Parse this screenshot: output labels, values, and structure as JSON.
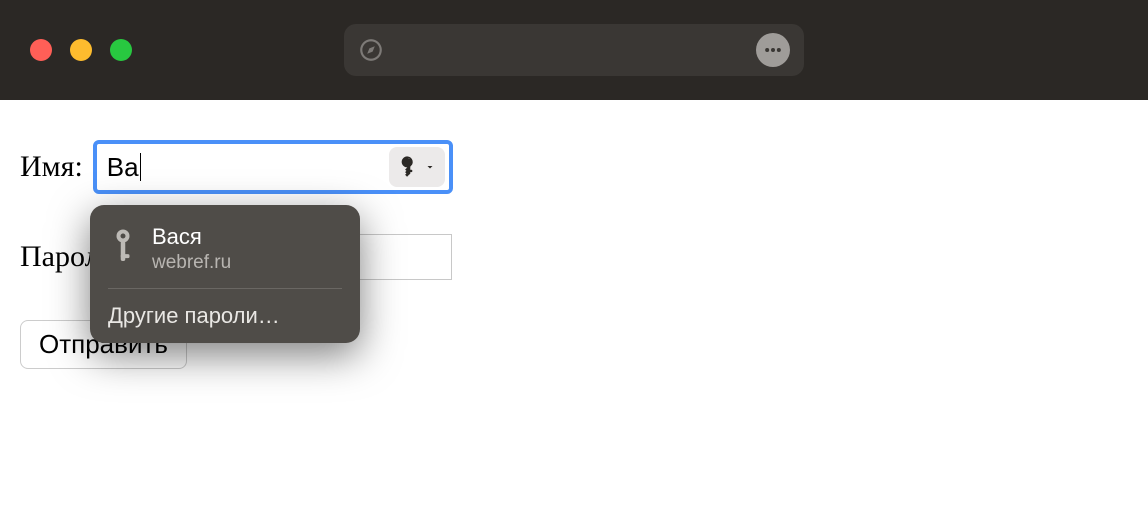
{
  "chrome": {
    "address": ""
  },
  "form": {
    "name_label": "Имя:",
    "name_value": "Ва",
    "password_label": "Пароль:",
    "password_value": "",
    "submit_label": "Отправить"
  },
  "autofill": {
    "username": "Вася",
    "site": "webref.ru",
    "other_passwords": "Другие пароли…"
  }
}
